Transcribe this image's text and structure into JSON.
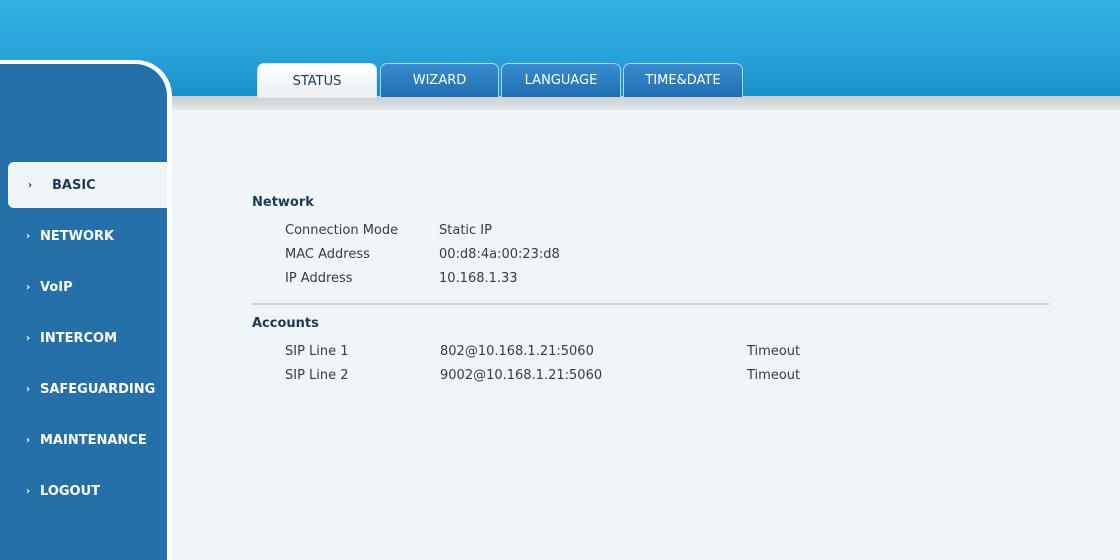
{
  "tabs": [
    {
      "label": "STATUS"
    },
    {
      "label": "WIZARD"
    },
    {
      "label": "LANGUAGE"
    },
    {
      "label": "TIME&DATE"
    }
  ],
  "sidebar": {
    "items": [
      {
        "label": "BASIC"
      },
      {
        "label": "NETWORK"
      },
      {
        "label": "VoIP"
      },
      {
        "label": "INTERCOM"
      },
      {
        "label": "SAFEGUARDING"
      },
      {
        "label": "MAINTENANCE"
      },
      {
        "label": "LOGOUT"
      }
    ]
  },
  "network": {
    "title": "Network",
    "rows": [
      {
        "label": "Connection Mode",
        "value": "Static IP"
      },
      {
        "label": "MAC Address",
        "value": "00:d8:4a:00:23:d8"
      },
      {
        "label": "IP Address",
        "value": "10.168.1.33"
      }
    ]
  },
  "accounts": {
    "title": "Accounts",
    "rows": [
      {
        "label": "SIP Line 1",
        "value": "802@10.168.1.21:5060",
        "status": "Timeout"
      },
      {
        "label": "SIP Line 2",
        "value": "9002@10.168.1.21:5060",
        "status": "Timeout"
      }
    ]
  },
  "colors": {
    "header_gradient_top": "#32b1e2",
    "header_gradient_bottom": "#1b8ec8",
    "sidebar": "#2570a8",
    "content_bg": "#f0f6f7",
    "heading_text": "#1d3a57"
  }
}
